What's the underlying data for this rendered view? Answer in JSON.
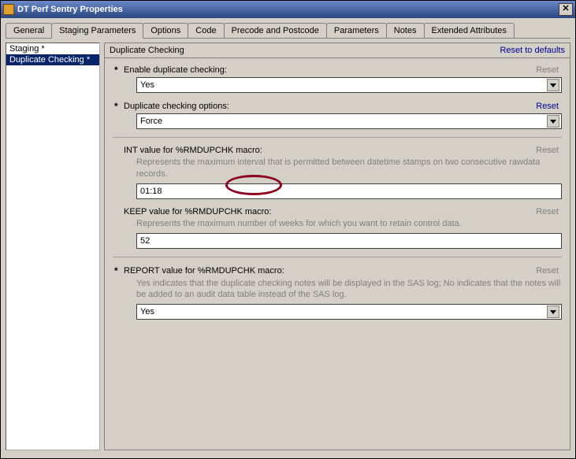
{
  "window": {
    "title": "DT Perf Sentry Properties"
  },
  "tabs": {
    "general": "General",
    "staging": "Staging Parameters",
    "options": "Options",
    "code": "Code",
    "prepost": "Precode and Postcode",
    "parameters": "Parameters",
    "notes": "Notes",
    "extattr": "Extended Attributes"
  },
  "tree": {
    "item0": "Staging *",
    "item1": "Duplicate Checking *"
  },
  "section": {
    "title": "Duplicate Checking",
    "reset_defaults": "Reset to defaults"
  },
  "rows": {
    "enable": {
      "label": "Enable duplicate checking:",
      "reset": "Reset",
      "value": "Yes"
    },
    "options": {
      "label": "Duplicate checking options:",
      "reset": "Reset",
      "value": "Force"
    },
    "int": {
      "label": "INT value for %RMDUPCHK macro:",
      "reset": "Reset",
      "help": "Represents the maximum interval that is permitted between datetime stamps on two consecutive rawdata records.",
      "value": "01:18"
    },
    "keep": {
      "label": "KEEP value for %RMDUPCHK macro:",
      "reset": "Reset",
      "help": "Represents the maximum number of weeks for which you want to retain control data.",
      "value": "52"
    },
    "report": {
      "label": "REPORT value for %RMDUPCHK macro:",
      "reset": "Reset",
      "help": "Yes indicates that the duplicate checking notes will be displayed in the SAS log; No indicates that the notes will be added to an audit data table instead of the SAS log.",
      "value": "Yes"
    }
  }
}
